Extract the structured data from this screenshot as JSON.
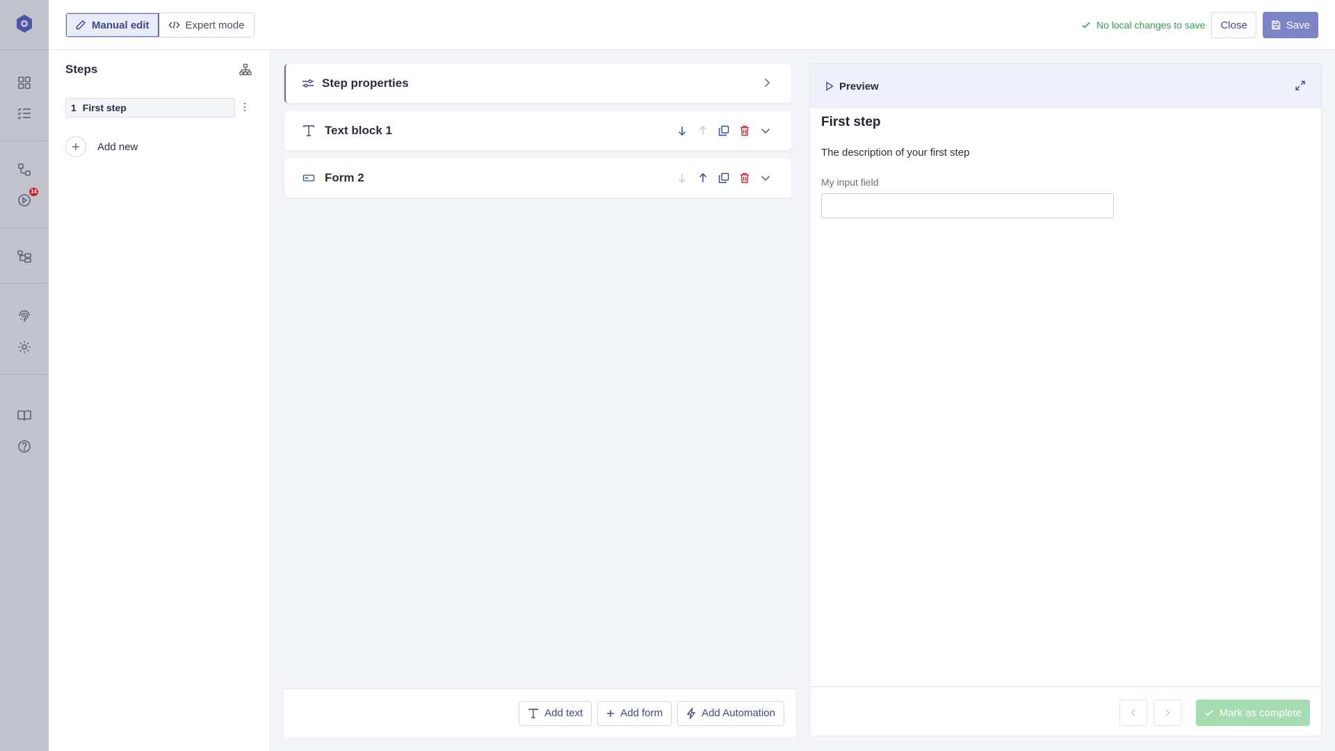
{
  "topbar": {
    "manual_edit_label": "Manual edit",
    "expert_mode_label": "Expert mode",
    "status_text": "No local changes to save",
    "close_label": "Close",
    "save_label": "Save"
  },
  "rail": {
    "badge_count": "14"
  },
  "steps": {
    "title": "Steps",
    "items": [
      {
        "number": "1",
        "label": "First step"
      }
    ],
    "add_new_label": "Add new"
  },
  "editor": {
    "step_properties_label": "Step properties",
    "blocks": [
      {
        "label": "Text block 1"
      },
      {
        "label": "Form 2"
      }
    ],
    "add_text_label": "Add text",
    "add_form_label": "Add form",
    "add_automation_label": "Add Automation"
  },
  "preview": {
    "header_label": "Preview",
    "step_title": "First step",
    "description": "The description of your first step",
    "field_label": "My input field",
    "field_value": "",
    "mark_complete_label": "Mark as complete"
  },
  "colors": {
    "accent": "#3a4796",
    "rail_bg": "#c2c4cd",
    "success": "#2fa350",
    "danger": "#d32029"
  }
}
